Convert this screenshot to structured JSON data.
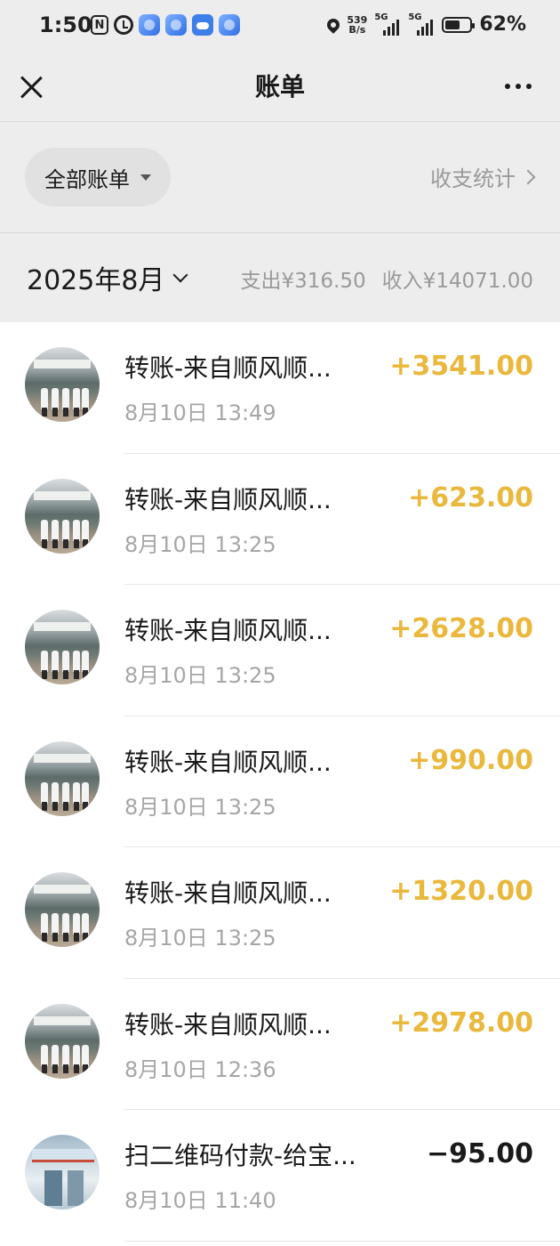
{
  "status_bar": {
    "time": "1:50",
    "nfc": "N",
    "net_speed_value": "539",
    "net_speed_unit": "B/s",
    "sig1_tag": "5G",
    "sig2_tag": "5G",
    "battery_level": 62,
    "battery_text": "62%"
  },
  "nav": {
    "title": "账单"
  },
  "filter": {
    "all_bills_label": "全部账单",
    "stats_label": "收支统计"
  },
  "month_bar": {
    "month": "2025年8月",
    "expense_summary": "支出¥316.50",
    "income_summary": "收入¥14071.00"
  },
  "transactions": [
    {
      "title": "转账-来自顺风顺...",
      "time": "8月10日 13:49",
      "amount": "+3541.00",
      "type": "income",
      "avatar": "group-photo"
    },
    {
      "title": "转账-来自顺风顺...",
      "time": "8月10日 13:25",
      "amount": "+623.00",
      "type": "income",
      "avatar": "group-photo"
    },
    {
      "title": "转账-来自顺风顺...",
      "time": "8月10日 13:25",
      "amount": "+2628.00",
      "type": "income",
      "avatar": "group-photo"
    },
    {
      "title": "转账-来自顺风顺...",
      "time": "8月10日 13:25",
      "amount": "+990.00",
      "type": "income",
      "avatar": "group-photo"
    },
    {
      "title": "转账-来自顺风顺...",
      "time": "8月10日 13:25",
      "amount": "+1320.00",
      "type": "income",
      "avatar": "group-photo"
    },
    {
      "title": "转账-来自顺风顺...",
      "time": "8月10日 12:36",
      "amount": "+2978.00",
      "type": "income",
      "avatar": "group-photo"
    },
    {
      "title": "扫二维码付款-给宝...",
      "time": "8月10日 11:40",
      "amount": "−95.00",
      "type": "expense",
      "avatar": "shop-photo"
    }
  ],
  "colors": {
    "income": "#e9b83c",
    "expense": "#1a1a1a",
    "header_bg": "#ededed"
  }
}
